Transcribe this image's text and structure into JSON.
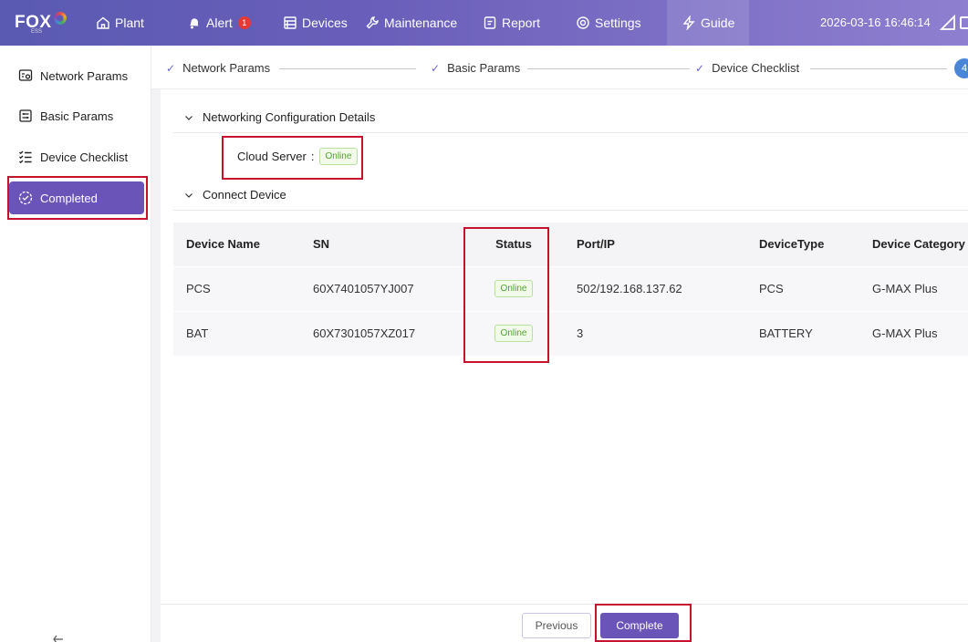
{
  "brand": {
    "logo_text": "FOX",
    "logo_sub": "ESS"
  },
  "nav": {
    "plant": "Plant",
    "alert": "Alert",
    "alert_count": "1",
    "devices": "Devices",
    "maintenance": "Maintenance",
    "report": "Report",
    "settings": "Settings",
    "guide": "Guide",
    "datetime": "2026-03-16 16:46:14"
  },
  "sidebar": {
    "items": [
      {
        "label": "Network Params",
        "icon": "network-icon"
      },
      {
        "label": "Basic Params",
        "icon": "sliders-icon"
      },
      {
        "label": "Device Checklist",
        "icon": "checklist-icon"
      },
      {
        "label": "Completed",
        "icon": "check-circle-icon",
        "active": true
      }
    ]
  },
  "steps": {
    "items": [
      {
        "label": "Network Params",
        "state": "done"
      },
      {
        "label": "Basic Params",
        "state": "done"
      },
      {
        "label": "Device Checklist",
        "state": "done"
      }
    ],
    "current_number": "4"
  },
  "networking": {
    "title": "Networking Configuration Details",
    "cloud_label": "Cloud Server",
    "cloud_separator": ":",
    "cloud_status": "Online"
  },
  "connect": {
    "title": "Connect Device",
    "columns": [
      "Device Name",
      "SN",
      "Status",
      "Port/IP",
      "DeviceType",
      "Device Category"
    ],
    "rows": [
      {
        "name": "PCS",
        "sn": "60X7401057YJ007",
        "status": "Online",
        "port": "502/192.168.137.62",
        "type": "PCS",
        "category": "G-MAX Plus"
      },
      {
        "name": "BAT",
        "sn": "60X7301057XZ017",
        "status": "Online",
        "port": "3",
        "type": "BATTERY",
        "category": "G-MAX Plus"
      }
    ]
  },
  "actions": {
    "previous": "Previous",
    "complete": "Complete"
  },
  "colors": {
    "accent": "#6a54b8",
    "highlight": "#c4122f",
    "online_green": "#55a32a",
    "step_blue": "#4a86d8"
  }
}
